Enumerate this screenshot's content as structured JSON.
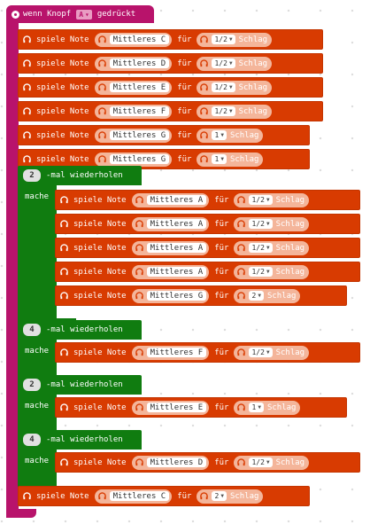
{
  "event": {
    "before": "wenn Knopf",
    "button": "A",
    "after": "gedrückt"
  },
  "words": {
    "spiele_note": "spiele Note",
    "fuer": "für",
    "schlag": "Schlag",
    "mal_wiederholen": "-mal wiederholen",
    "mache": "mache"
  },
  "top_notes": [
    {
      "note": "Mittleres C",
      "beat": "1/2"
    },
    {
      "note": "Mittleres D",
      "beat": "1/2"
    },
    {
      "note": "Mittleres E",
      "beat": "1/2"
    },
    {
      "note": "Mittleres F",
      "beat": "1/2"
    },
    {
      "note": "Mittleres G",
      "beat": "1"
    },
    {
      "note": "Mittleres G",
      "beat": "1"
    }
  ],
  "loops": [
    {
      "count": "2",
      "notes": [
        {
          "note": "Mittleres A",
          "beat": "1/2"
        },
        {
          "note": "Mittleres A",
          "beat": "1/2"
        },
        {
          "note": "Mittleres A",
          "beat": "1/2"
        },
        {
          "note": "Mittleres A",
          "beat": "1/2"
        },
        {
          "note": "Mittleres G",
          "beat": "2"
        }
      ]
    },
    {
      "count": "4",
      "notes": [
        {
          "note": "Mittleres F",
          "beat": "1/2"
        }
      ]
    },
    {
      "count": "2",
      "notes": [
        {
          "note": "Mittleres E",
          "beat": "1"
        }
      ]
    },
    {
      "count": "4",
      "notes": [
        {
          "note": "Mittleres D",
          "beat": "1/2"
        }
      ]
    }
  ],
  "final_note": {
    "note": "Mittleres C",
    "beat": "2"
  },
  "colors": {
    "event": "#b8136b",
    "music": "#d83b01",
    "loop": "#107c10",
    "workspace": "#ffffff"
  },
  "icons": [
    "event-gear-icon",
    "headphones-icon",
    "dropdown-arrow-icon"
  ]
}
